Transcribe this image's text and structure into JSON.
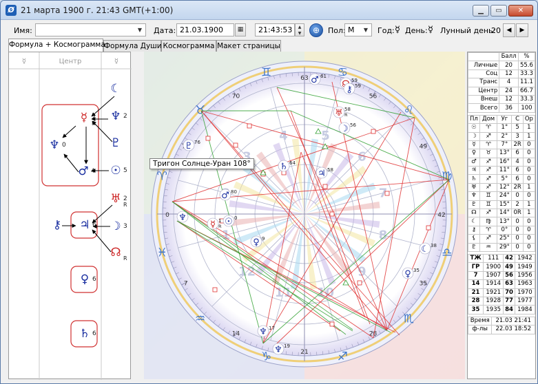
{
  "window": {
    "title": "21 марта 1900 г. 21:43 GMT(+1:00)",
    "icon": "app-logo-icon",
    "controls": [
      "minimize-icon",
      "maximize-icon",
      "close-icon"
    ]
  },
  "toolbar": {
    "name_label": "Имя:",
    "name_value": "",
    "date_label": "Дата:",
    "date_value": "21.03.1900",
    "time_value": "21:43:53",
    "gender_label": "Пол:",
    "gender_value": "М",
    "year_label": "Год:",
    "year_glyph": "☿",
    "day_label": "День:",
    "day_glyph": "☿",
    "lunar_label": "Лунный день:",
    "lunar_value": "20"
  },
  "tabs": [
    {
      "label": "Формула + Космограмма",
      "active": true
    },
    {
      "label": "Формула Души",
      "active": false
    },
    {
      "label": "Космограмма",
      "active": false
    },
    {
      "label": "Макет страницы",
      "active": false
    }
  ],
  "formula": {
    "header": [
      "☿",
      "Центр",
      "☿"
    ],
    "groups": [
      {
        "items": [
          {
            "glyph": "☿",
            "num": "2",
            "sub": "R",
            "color": "#cc2222"
          },
          {
            "glyph": "♆",
            "num": "0",
            "sub": "",
            "color": "#1a2fa0"
          },
          {
            "glyph": "♂",
            "num": "4",
            "sub": "",
            "color": "#1a2fa0"
          }
        ]
      },
      {
        "items": [
          {
            "glyph": "♃",
            "num": "6",
            "sub": "",
            "color": "#1a2fa0"
          }
        ]
      },
      {
        "items": [
          {
            "glyph": "♀",
            "num": "6",
            "sub": "",
            "color": "#1a2fa0"
          }
        ]
      },
      {
        "items": [
          {
            "glyph": "♄",
            "num": "6",
            "sub": "",
            "color": "#1a2fa0"
          }
        ]
      }
    ],
    "side": [
      {
        "glyph": "☾",
        "num": "",
        "sub": "",
        "color": "#1a2fa0"
      },
      {
        "glyph": "♆",
        "num": "2",
        "sub": "",
        "color": "#1a2fa0"
      },
      {
        "glyph": "♇",
        "num": "",
        "sub": "",
        "color": "#1a2fa0"
      },
      {
        "glyph": "☉",
        "num": "5",
        "sub": "",
        "color": "#1a2fa0"
      },
      {
        "glyph": "♅",
        "num": "2",
        "sub": "R",
        "color": "#cc2222"
      },
      {
        "glyph": "☽",
        "num": "3",
        "sub": "",
        "color": "#1a2fa0"
      },
      {
        "glyph": "☊",
        "num": "",
        "sub": "R",
        "color": "#cc2222"
      },
      {
        "glyph": "⚷",
        "num": "",
        "sub": "",
        "color": "#1a2fa0"
      }
    ]
  },
  "tooltip": "Тригон Солнце-Уран 108°",
  "cosmogram": {
    "zodiac": [
      "♈",
      "♉",
      "♊",
      "♋",
      "♌",
      "♍",
      "♎",
      "♏",
      "♐",
      "♑",
      "♒",
      "♓"
    ],
    "degree_labels": [
      "63",
      "56",
      "49",
      "42",
      "35",
      "28",
      "21",
      "14",
      "7",
      "0",
      "77",
      "70"
    ],
    "house_numbers": [
      "1",
      "2",
      "3",
      "4",
      "5",
      "6",
      "7",
      "8",
      "9",
      "10",
      "11",
      "12"
    ],
    "planets": [
      {
        "glyph": "♂",
        "num": "61",
        "sub": "",
        "color": "#1a2fa0"
      },
      {
        "glyph": "☊",
        "num": "59",
        "sub": "R",
        "color": "#cc2222"
      },
      {
        "glyph": "⚷",
        "num": "59",
        "sub": "",
        "color": "#1a2fa0"
      },
      {
        "glyph": "♅",
        "num": "58",
        "sub": "R",
        "color": "#cc2222"
      },
      {
        "glyph": "☽",
        "num": "56",
        "sub": "",
        "color": "#1a2fa0"
      },
      {
        "glyph": "♄",
        "num": "64",
        "sub": "",
        "color": "#1a2fa0"
      },
      {
        "glyph": "♃",
        "num": "58",
        "sub": "",
        "color": "#1a2fa0"
      },
      {
        "glyph": "♇",
        "num": "76",
        "sub": "",
        "color": "#1a2fa0"
      },
      {
        "glyph": "♂",
        "num": "80",
        "sub": "",
        "color": "#1a2fa0"
      },
      {
        "glyph": "♆",
        "num": "",
        "sub": "",
        "color": "#1a2fa0"
      },
      {
        "glyph": "☿",
        "num": "1",
        "sub": "R",
        "color": "#cc2222"
      },
      {
        "glyph": "☉",
        "num": "0",
        "sub": "",
        "color": "#1a2fa0"
      },
      {
        "glyph": "♀",
        "num": "9",
        "sub": "",
        "color": "#1a2fa0"
      },
      {
        "glyph": "☾",
        "num": "38",
        "sub": "",
        "color": "#1a2fa0"
      },
      {
        "glyph": "♀",
        "num": "35",
        "sub": "",
        "color": "#1a2fa0"
      },
      {
        "glyph": "♆",
        "num": "17",
        "sub": "",
        "color": "#1a2fa0"
      },
      {
        "glyph": "♆",
        "num": "19",
        "sub": "",
        "color": "#1a2fa0"
      }
    ]
  },
  "scores": {
    "header": [
      "",
      "Балл",
      "%"
    ],
    "rows": [
      [
        "Личные",
        "20",
        "55.6"
      ],
      [
        "Соц",
        "12",
        "33.3"
      ],
      [
        "Транс",
        "4",
        "11.1"
      ],
      [
        "Центр",
        "24",
        "66.7"
      ],
      [
        "Внеш",
        "12",
        "33.3"
      ],
      [
        "Всего",
        "36",
        "100"
      ]
    ]
  },
  "positions": {
    "header": [
      "Пл",
      "Дом",
      "Уг",
      "С",
      "Ор"
    ],
    "rows": [
      [
        "☉",
        "♈",
        "1°",
        "5",
        "1"
      ],
      [
        "☽",
        "♐",
        "2°",
        "3",
        "1"
      ],
      [
        "☿",
        "♈",
        "7°",
        "2R",
        "0"
      ],
      [
        "♀",
        "♉",
        "13°",
        "6",
        "0"
      ],
      [
        "♂",
        "♐",
        "16°",
        "4",
        "0"
      ],
      [
        "♃",
        "♐",
        "11°",
        "6",
        "0"
      ],
      [
        "♄",
        "♐",
        "5°",
        "6",
        "0"
      ],
      [
        "♅",
        "♐",
        "12°",
        "2R",
        "1"
      ],
      [
        "♆",
        "♊",
        "24°",
        "0",
        "0"
      ],
      [
        "♇",
        "♊",
        "15°",
        "2",
        "1"
      ],
      [
        "☊",
        "♐",
        "14°",
        "0R",
        "1"
      ],
      [
        "☾",
        "♍",
        "13°",
        "0",
        "0"
      ],
      [
        "⚷",
        "♈",
        "0°",
        "0",
        "0"
      ],
      [
        "⚸",
        "♐",
        "25°",
        "0",
        "0"
      ],
      [
        "♇",
        "♒",
        "29°",
        "0",
        "0"
      ]
    ]
  },
  "cycles": {
    "rows": [
      [
        "ТЖ",
        "111",
        "42",
        "1942"
      ],
      [
        "ГР",
        "1900",
        "49",
        "1949"
      ],
      [
        "7",
        "1907",
        "56",
        "1956"
      ],
      [
        "14",
        "1914",
        "63",
        "1963"
      ],
      [
        "21",
        "1921",
        "70",
        "1970"
      ],
      [
        "28",
        "1928",
        "77",
        "1977"
      ],
      [
        "35",
        "1935",
        "84",
        "1984"
      ]
    ]
  },
  "footer": {
    "rows": [
      [
        "Время",
        "21.03 21:41"
      ],
      [
        "ф-лы",
        "22.03 18:52"
      ]
    ]
  }
}
